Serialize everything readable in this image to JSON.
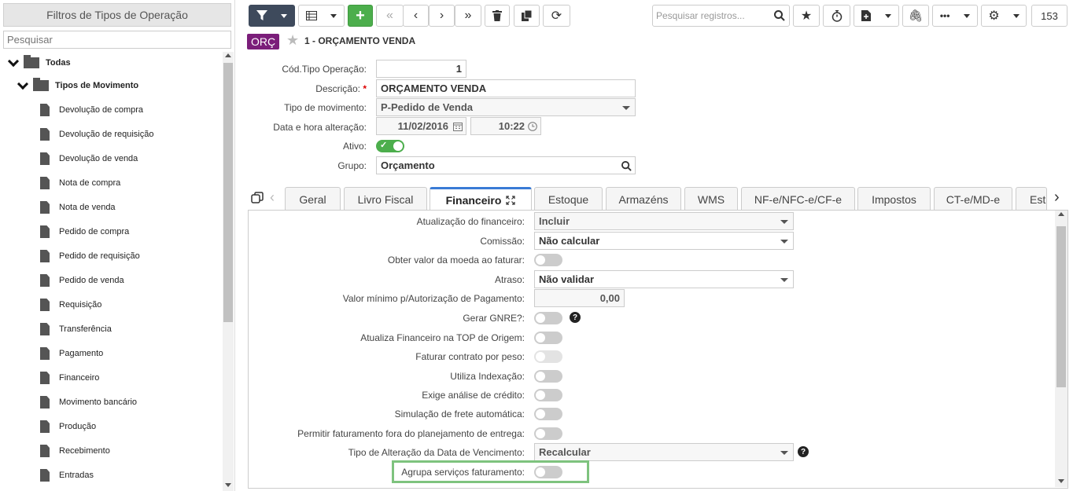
{
  "left_panel": {
    "title": "Filtros de Tipos de Operação",
    "search_placeholder": "Pesquisar",
    "root_label": "Todas",
    "group_label": "Tipos de Movimento",
    "items": [
      "Devolução de compra",
      "Devolução de requisição",
      "Devolução de venda",
      "Nota de compra",
      "Nota de venda",
      "Pedido de compra",
      "Pedido de requisição",
      "Pedido de venda",
      "Requisição",
      "Transferência",
      "Pagamento",
      "Financeiro",
      "Movimento bancário",
      "Produção",
      "Recebimento",
      "Entradas"
    ]
  },
  "toolbar": {
    "search_placeholder": "Pesquisar registros...",
    "record_count": "153",
    "icons": [
      "filter-icon",
      "grid-icon",
      "add-icon",
      "first-icon",
      "prev-icon",
      "next-icon",
      "last-icon",
      "delete-icon",
      "copy-icon",
      "refresh-icon",
      "search-icon",
      "star-icon",
      "stopwatch-icon",
      "export-icon",
      "attach-icon",
      "more-icon",
      "gear-icon"
    ]
  },
  "record": {
    "badge": "ORÇ",
    "title": "1 - ORÇAMENTO VENDA"
  },
  "form": {
    "cod_label": "Cód.Tipo Operação:",
    "cod_value": "1",
    "desc_label": "Descrição:",
    "desc_required": "*",
    "desc_value": "ORÇAMENTO VENDA",
    "tipo_label": "Tipo de movimento:",
    "tipo_value": "P-Pedido de Venda",
    "data_label": "Data e hora alteração:",
    "data_value": "11/02/2016",
    "hora_value": "10:22",
    "ativo_label": "Ativo:",
    "grupo_label": "Grupo:",
    "grupo_value": "Orçamento"
  },
  "tabs": [
    "Geral",
    "Livro Fiscal",
    "Financeiro",
    "Estoque",
    "Armazéns",
    "WMS",
    "NF-e/NFC-e/CF-e",
    "Impostos",
    "CT-e/MD-e",
    "Est"
  ],
  "active_tab": "Financeiro",
  "financeiro": {
    "atualizacao_label": "Atualização do financeiro:",
    "atualizacao_value": "Incluir",
    "comissao_label": "Comissão:",
    "comissao_value": "Não calcular",
    "obter_moeda_label": "Obter valor da moeda ao faturar:",
    "atraso_label": "Atraso:",
    "atraso_value": "Não validar",
    "valor_min_label": "Valor mínimo p/Autorização de Pagamento:",
    "valor_min_value": "0,00",
    "gnre_label": "Gerar GNRE?:",
    "atualiza_top_label": "Atualiza Financeiro na TOP de Origem:",
    "faturar_peso_label": "Faturar contrato por peso:",
    "indexacao_label": "Utiliza Indexação:",
    "analise_label": "Exige análise de crédito:",
    "frete_label": "Simulação de frete automática:",
    "fora_plan_label": "Permitir faturamento fora do planejamento de entrega:",
    "tipo_alt_label": "Tipo de Alteração da Data de Vencimento:",
    "tipo_alt_value": "Recalcular",
    "agrupa_label": "Agrupa serviços faturamento:",
    "help_glyph": "?"
  },
  "colors": {
    "accent": "#3e4a5c",
    "green": "#4cae4c",
    "badge": "#7b1e7a",
    "highlight": "#7ec37e"
  }
}
